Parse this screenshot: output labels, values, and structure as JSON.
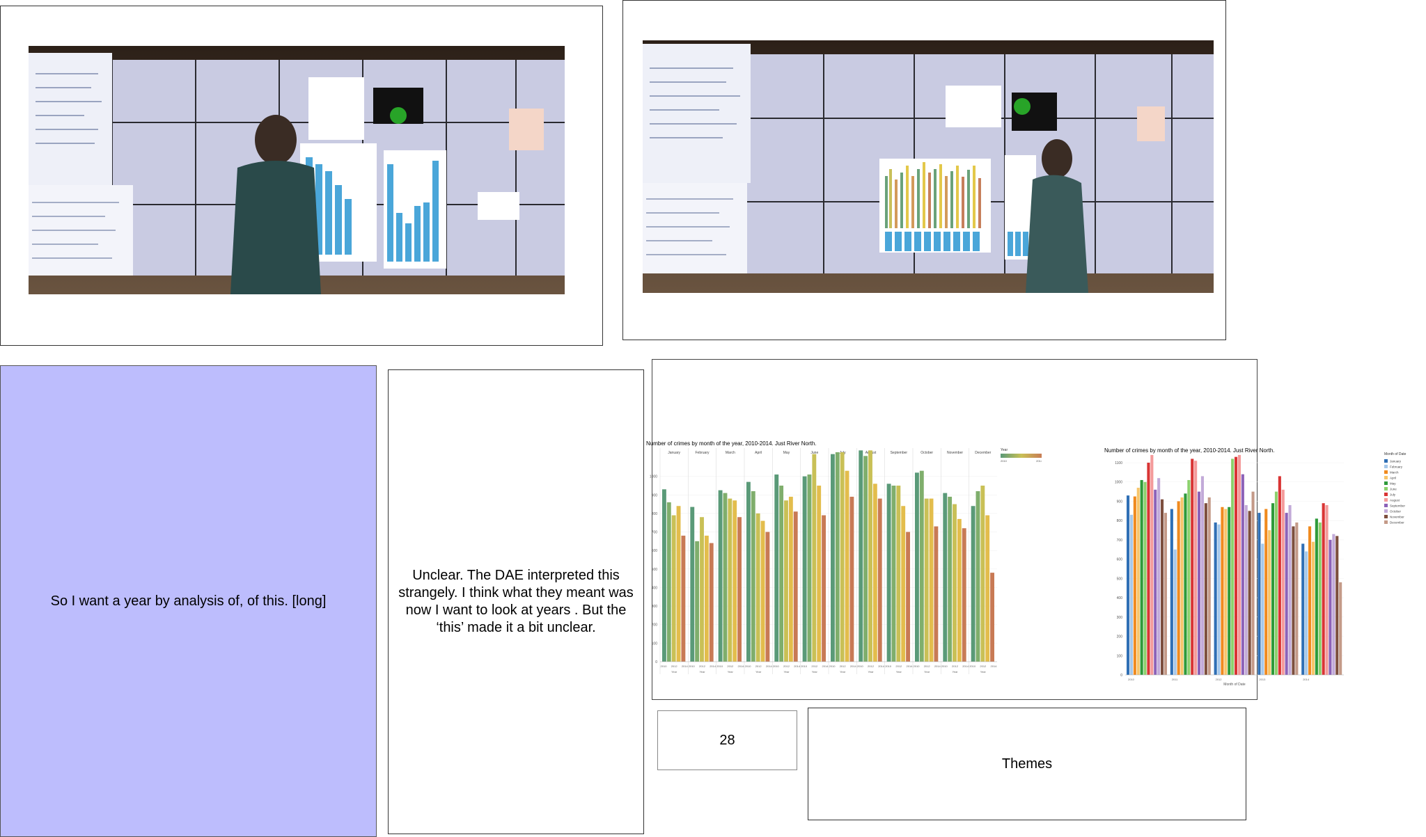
{
  "cards": {
    "quote_text": "So I want a year by analysis of, of this. [long]",
    "note_text": "Unclear.  The DAE interpreted this strangely.  I think what they meant was now I want to look at years .  But the ‘this’ made it a bit unclear.",
    "count_text": "28",
    "themes_text": "Themes"
  },
  "colors": {
    "quote_bg": "#bdbdfd",
    "wall_screen": "#c9cbe2",
    "bar_blue": "#4aa6d9"
  },
  "chart_data": [
    {
      "type": "bar",
      "title": "Number of crimes by month of the year, 2010-2014.  Just River North.",
      "categories": [
        "January",
        "February",
        "March",
        "April",
        "May",
        "June",
        "July",
        "August",
        "September",
        "October",
        "November",
        "December"
      ],
      "x_ticks": [
        "2010",
        "2012",
        "2014"
      ],
      "x_axis_label": "Year",
      "legend_title": "Year",
      "legend_range": [
        "2010",
        "2014"
      ],
      "ylim": [
        0,
        1100
      ],
      "y_ticks": [
        0,
        100,
        200,
        300,
        400,
        500,
        600,
        700,
        800,
        900,
        1000
      ],
      "series": [
        {
          "values": [
            930,
            835,
            925,
            970,
            1010,
            1000,
            1120,
            1140,
            960,
            1020,
            910,
            840
          ]
        },
        {
          "values": [
            860,
            650,
            910,
            920,
            950,
            1010,
            1130,
            1110,
            950,
            1030,
            890,
            920
          ]
        },
        {
          "values": [
            790,
            780,
            880,
            800,
            870,
            1120,
            1130,
            1140,
            950,
            880,
            850,
            950
          ]
        },
        {
          "values": [
            840,
            680,
            870,
            760,
            890,
            950,
            1030,
            960,
            840,
            880,
            770,
            790
          ]
        },
        {
          "values": [
            680,
            640,
            780,
            700,
            810,
            790,
            890,
            880,
            700,
            730,
            720,
            480
          ]
        }
      ]
    },
    {
      "type": "bar",
      "title": "Number of crimes by month of the year, 2010-2014.  Just River North.",
      "categories": [
        "2010",
        "2011",
        "2012",
        "2013",
        "2014"
      ],
      "x_axis_label": "Month of Date",
      "legend_title": "Month of Date",
      "legend": [
        "January",
        "February",
        "March",
        "April",
        "May",
        "June",
        "July",
        "August",
        "September",
        "October",
        "November",
        "December"
      ],
      "ylim": [
        0,
        1100
      ],
      "y_ticks": [
        0,
        100,
        200,
        300,
        400,
        500,
        600,
        700,
        800,
        900,
        1000,
        1100
      ],
      "series": [
        {
          "name": "January",
          "values": [
            930,
            860,
            790,
            840,
            680
          ]
        },
        {
          "name": "February",
          "values": [
            830,
            650,
            780,
            680,
            640
          ]
        },
        {
          "name": "March",
          "values": [
            925,
            900,
            870,
            860,
            770
          ]
        },
        {
          "name": "April",
          "values": [
            970,
            920,
            860,
            750,
            690
          ]
        },
        {
          "name": "May",
          "values": [
            1010,
            940,
            870,
            890,
            810
          ]
        },
        {
          "name": "June",
          "values": [
            1000,
            1010,
            1120,
            950,
            790
          ]
        },
        {
          "name": "July",
          "values": [
            1100,
            1120,
            1130,
            1030,
            890
          ]
        },
        {
          "name": "August",
          "values": [
            1140,
            1110,
            1140,
            960,
            880
          ]
        },
        {
          "name": "September",
          "values": [
            960,
            950,
            1040,
            840,
            700
          ]
        },
        {
          "name": "October",
          "values": [
            1020,
            1030,
            880,
            880,
            730
          ]
        },
        {
          "name": "November",
          "values": [
            910,
            890,
            850,
            770,
            720
          ]
        },
        {
          "name": "December",
          "values": [
            840,
            920,
            950,
            790,
            480
          ]
        }
      ]
    }
  ]
}
